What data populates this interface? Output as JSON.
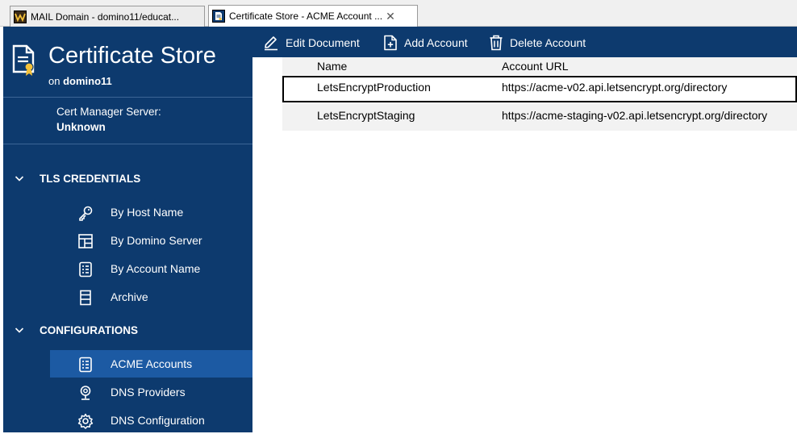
{
  "tabs": [
    {
      "label": "MAIL Domain - domino11/educat...",
      "icon": "domino-db-icon"
    },
    {
      "label": "Certificate Store - ACME Account ...",
      "icon": "document-icon",
      "close": "✕"
    }
  ],
  "sidebar": {
    "title": "Certificate Store",
    "subtitle_prefix": "on",
    "server_name": "domino11",
    "cert_manager_label": "Cert Manager Server:",
    "cert_manager_value": "Unknown",
    "sections": [
      {
        "label": "TLS CREDENTIALS",
        "items": [
          {
            "label": "By Host Name",
            "icon": "key-icon"
          },
          {
            "label": "By Domino Server",
            "icon": "layout-icon"
          },
          {
            "label": "By Account Name",
            "icon": "list-icon"
          },
          {
            "label": "Archive",
            "icon": "archive-icon"
          }
        ]
      },
      {
        "label": "CONFIGURATIONS",
        "items": [
          {
            "label": "ACME Accounts",
            "icon": "list-icon",
            "active": true
          },
          {
            "label": "DNS Providers",
            "icon": "location-icon"
          },
          {
            "label": "DNS Configuration",
            "icon": "gear-icon"
          }
        ]
      }
    ]
  },
  "toolbar": {
    "edit_label": "Edit Document",
    "add_label": "Add Account",
    "delete_label": "Delete Account"
  },
  "table": {
    "columns": [
      "Name",
      "Account URL"
    ],
    "rows": [
      {
        "name": "LetsEncryptProduction",
        "url": "https://acme-v02.api.letsencrypt.org/directory",
        "selected": true
      },
      {
        "name": "LetsEncryptStaging",
        "url": "https://acme-staging-v02.api.letsencrypt.org/directory",
        "selected": false
      }
    ]
  },
  "colors": {
    "sidebar_bg": "#0d3a6e",
    "active_item": "#1c5aa3",
    "row_alt": "#f2f2f2"
  }
}
